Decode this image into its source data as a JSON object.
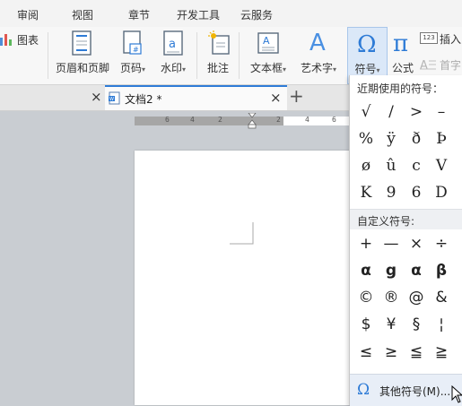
{
  "menubar": {
    "items": [
      "审阅",
      "视图",
      "章节",
      "开发工具",
      "云服务"
    ]
  },
  "ribbon": {
    "chart_label": "图表",
    "header_footer_label": "页眉和页脚",
    "page_number_label": "页码",
    "watermark_label": "水印",
    "comment_label": "批注",
    "textbox_label": "文本框",
    "wordart_label": "艺术字",
    "symbol_label": "符号",
    "formula_label": "公式",
    "insert_label": "插入",
    "dropcap_label": "首字",
    "badge_text": "123",
    "dropdown_caret": "▾"
  },
  "tabbar": {
    "close_left": "×",
    "doc_tab_title": "文档2 *",
    "doc_tab_close": "×",
    "new_tab": "+"
  },
  "ruler": {
    "labels": [
      "6",
      "4",
      "2",
      "2",
      "4",
      "6"
    ]
  },
  "symbol_panel": {
    "recent_title": "近期使用的符号：",
    "recent_symbols": [
      "√",
      "/",
      ">",
      "–",
      "%",
      "ÿ",
      "ð",
      "Þ",
      "ø",
      "û",
      "c",
      "V",
      "K",
      "9",
      "6",
      "D"
    ],
    "custom_title": "自定义符号:",
    "custom_symbols": [
      "+",
      "—",
      "×",
      "÷",
      "α",
      "g",
      "α",
      "β",
      "©",
      "®",
      "@",
      "&",
      "$",
      "¥",
      "§",
      "¦",
      "≤",
      "≥",
      "≦",
      "≧"
    ],
    "more_label": "其他符号(M)..."
  },
  "colors": {
    "accent": "#2e7bd6",
    "menubar_bg": "#f3f3f3",
    "ribbon_bg": "#f7f7f7",
    "doc_bg": "#c9cdd2",
    "panel_section_bg": "#eef0f3",
    "highlight_bg": "#dbe8f8"
  }
}
